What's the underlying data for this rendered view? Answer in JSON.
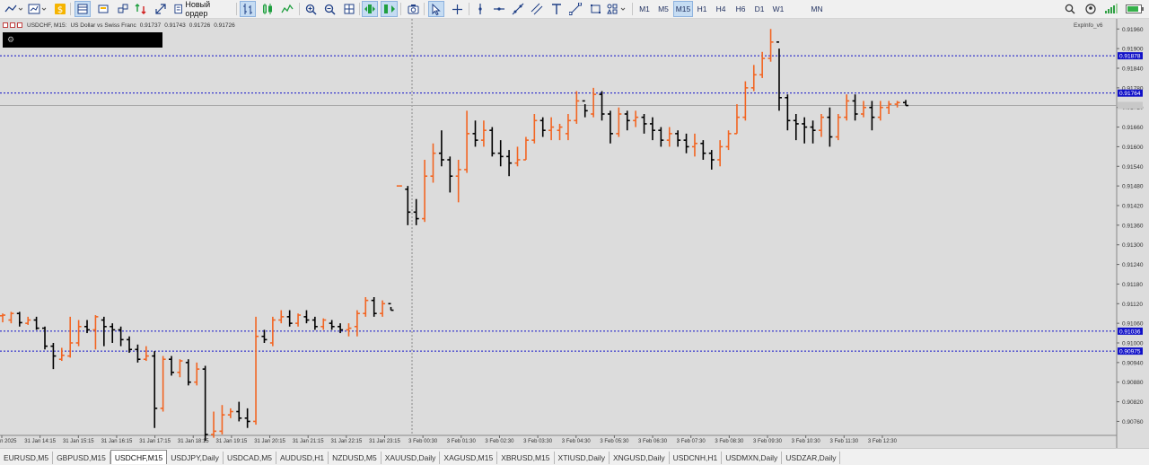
{
  "toolbar": {
    "new_order_label": "Новый ордер",
    "timeframes": [
      "M1",
      "M5",
      "M15",
      "H1",
      "H4",
      "H6",
      "D1",
      "W1",
      "MN"
    ],
    "active_timeframe": "M15"
  },
  "chart_header": {
    "symbol": "USDCHF, M15:",
    "description": "US Dollar vs Swiss Franc",
    "ohlc": [
      "0.91737",
      "0.91743",
      "0.91726",
      "0.91726"
    ],
    "indicator": "ExpInfo_v6"
  },
  "colors": {
    "bull": "#f26522",
    "bear": "#000000",
    "hline": "#1010c8",
    "price_tag": "#1010c8",
    "bg": "#dcdcdc"
  },
  "chart_data": {
    "type": "ohlc-bar",
    "symbol": "USDCHF",
    "timeframe": "M15",
    "ylim": [
      0.9072,
      0.9198
    ],
    "y_ticks": [
      "0.91960",
      "0.91900",
      "0.91840",
      "0.91780",
      "0.91720",
      "0.91660",
      "0.91600",
      "0.91540",
      "0.91480",
      "0.91420",
      "0.91360",
      "0.91300",
      "0.91240",
      "0.91180",
      "0.91120",
      "0.91060",
      "0.91000",
      "0.90940",
      "0.90880",
      "0.90820",
      "0.90760"
    ],
    "x_ticks": [
      "31 Jan 2025",
      "31 Jan 14:15",
      "31 Jan 15:15",
      "31 Jan 16:15",
      "31 Jan 17:15",
      "31 Jan 18:15",
      "31 Jan 19:15",
      "31 Jan 20:15",
      "31 Jan 21:15",
      "31 Jan 22:15",
      "31 Jan 23:15",
      "3 Feb 00:30",
      "3 Feb 01:30",
      "3 Feb 02:30",
      "3 Feb 03:30",
      "3 Feb 04:30",
      "3 Feb 05:30",
      "3 Feb 06:30",
      "3 Feb 07:30",
      "3 Feb 08:30",
      "3 Feb 09:30",
      "3 Feb 10:30",
      "3 Feb 11:30",
      "3 Feb 12:30"
    ],
    "hlines": [
      {
        "price": 0.91878,
        "label": "0.91878"
      },
      {
        "price": 0.91764,
        "label": "0.91764"
      },
      {
        "price": 0.91036,
        "label": "0.91036"
      },
      {
        "price": 0.90975,
        "label": "0.90975"
      }
    ],
    "current_price": 0.91726,
    "bars": [
      [
        0.91083,
        0.9109,
        0.91063,
        0.91085
      ],
      [
        0.9107,
        0.91095,
        0.9106,
        0.9109
      ],
      [
        0.9109,
        0.91095,
        0.9105,
        0.91062
      ],
      [
        0.9106,
        0.9108,
        0.91055,
        0.9107
      ],
      [
        0.9107,
        0.9108,
        0.9104,
        0.91045
      ],
      [
        0.91045,
        0.9105,
        0.9098,
        0.9099
      ],
      [
        0.9099,
        0.91,
        0.9092,
        0.9096
      ],
      [
        0.9095,
        0.90985,
        0.90945,
        0.90962
      ],
      [
        0.9096,
        0.9108,
        0.90955,
        0.91
      ],
      [
        0.91,
        0.9107,
        0.9099,
        0.9105
      ],
      [
        0.9105,
        0.9107,
        0.9103,
        0.9104
      ],
      [
        0.9104,
        0.91085,
        0.9098,
        0.9108
      ],
      [
        0.9107,
        0.9108,
        0.9099,
        0.9105
      ],
      [
        0.9105,
        0.9106,
        0.91,
        0.9104
      ],
      [
        0.9104,
        0.9105,
        0.9099,
        0.9101
      ],
      [
        0.9101,
        0.9102,
        0.9097,
        0.9098
      ],
      [
        0.9098,
        0.90995,
        0.9094,
        0.9095
      ],
      [
        0.9095,
        0.9099,
        0.90945,
        0.9096
      ],
      [
        0.9096,
        0.90975,
        0.9074,
        0.908
      ],
      [
        0.908,
        0.9096,
        0.9079,
        0.9095
      ],
      [
        0.9095,
        0.9096,
        0.909,
        0.9091
      ],
      [
        0.9091,
        0.9095,
        0.90895,
        0.90945
      ],
      [
        0.9094,
        0.9095,
        0.9087,
        0.9088
      ],
      [
        0.9088,
        0.9094,
        0.9087,
        0.9092
      ],
      [
        0.9092,
        0.9093,
        0.907,
        0.9072
      ],
      [
        0.9072,
        0.9079,
        0.9071,
        0.9073
      ],
      [
        0.9073,
        0.9081,
        0.9072,
        0.9078
      ],
      [
        0.9078,
        0.908,
        0.9077,
        0.9079
      ],
      [
        0.9079,
        0.9082,
        0.9076,
        0.9077
      ],
      [
        0.9077,
        0.908,
        0.9074,
        0.9076
      ],
      [
        0.9076,
        0.9108,
        0.9075,
        0.9102
      ],
      [
        0.9102,
        0.9104,
        0.91,
        0.9101
      ],
      [
        0.91,
        0.9108,
        0.9099,
        0.9107
      ],
      [
        0.9107,
        0.911,
        0.9106,
        0.9108
      ],
      [
        0.9108,
        0.911,
        0.9105,
        0.9106
      ],
      [
        0.9106,
        0.9109,
        0.9105,
        0.91085
      ],
      [
        0.9108,
        0.911,
        0.9106,
        0.9107
      ],
      [
        0.9107,
        0.9108,
        0.9104,
        0.9105
      ],
      [
        0.9105,
        0.91075,
        0.9104,
        0.9107
      ],
      [
        0.9106,
        0.9107,
        0.9104,
        0.9105
      ],
      [
        0.9105,
        0.9106,
        0.9103,
        0.9104
      ],
      [
        0.9104,
        0.9106,
        0.9102,
        0.91045
      ],
      [
        0.9105,
        0.911,
        0.9102,
        0.9109
      ],
      [
        0.9109,
        0.9114,
        0.9108,
        0.9113
      ],
      [
        0.9113,
        0.9114,
        0.9108,
        0.9109
      ],
      [
        0.9109,
        0.9113,
        0.9108,
        0.9112
      ],
      [
        0.9112,
        0.9111,
        0.911,
        0.911
      ],
      [
        0.9148,
        0.9148,
        0.9148,
        0.9148
      ],
      [
        0.9147,
        0.9148,
        0.9136,
        0.914
      ],
      [
        0.914,
        0.9144,
        0.9136,
        0.9138
      ],
      [
        0.9138,
        0.9156,
        0.9137,
        0.9151
      ],
      [
        0.9151,
        0.9161,
        0.9149,
        0.9158
      ],
      [
        0.9158,
        0.9165,
        0.9154,
        0.9156
      ],
      [
        0.9156,
        0.9157,
        0.9146,
        0.9151
      ],
      [
        0.9151,
        0.9156,
        0.9143,
        0.9153
      ],
      [
        0.9153,
        0.9171,
        0.9152,
        0.9164
      ],
      [
        0.9164,
        0.9168,
        0.916,
        0.9162
      ],
      [
        0.9162,
        0.9168,
        0.916,
        0.9165
      ],
      [
        0.9165,
        0.9166,
        0.9157,
        0.9158
      ],
      [
        0.9158,
        0.9162,
        0.9154,
        0.9157
      ],
      [
        0.9157,
        0.9159,
        0.9151,
        0.9155
      ],
      [
        0.9155,
        0.916,
        0.9154,
        0.9156
      ],
      [
        0.9156,
        0.9163,
        0.9156,
        0.9162
      ],
      [
        0.9162,
        0.917,
        0.9161,
        0.9168
      ],
      [
        0.9168,
        0.9169,
        0.9163,
        0.9165
      ],
      [
        0.9165,
        0.9169,
        0.9162,
        0.9166
      ],
      [
        0.9165,
        0.9167,
        0.9162,
        0.9166
      ],
      [
        0.9164,
        0.917,
        0.9162,
        0.9168
      ],
      [
        0.9168,
        0.9177,
        0.9167,
        0.9174
      ],
      [
        0.9174,
        0.9173,
        0.9169,
        0.9171
      ],
      [
        0.917,
        0.9178,
        0.9169,
        0.9176
      ],
      [
        0.9176,
        0.9177,
        0.9168,
        0.917
      ],
      [
        0.917,
        0.9171,
        0.9161,
        0.9164
      ],
      [
        0.9164,
        0.9172,
        0.9163,
        0.917
      ],
      [
        0.917,
        0.9171,
        0.9165,
        0.9168
      ],
      [
        0.9168,
        0.9171,
        0.9166,
        0.9169
      ],
      [
        0.9169,
        0.917,
        0.9164,
        0.9167
      ],
      [
        0.9167,
        0.9169,
        0.9162,
        0.9165
      ],
      [
        0.9165,
        0.9166,
        0.916,
        0.9162
      ],
      [
        0.9162,
        0.9166,
        0.916,
        0.9164
      ],
      [
        0.9164,
        0.9165,
        0.916,
        0.9162
      ],
      [
        0.9162,
        0.9164,
        0.9158,
        0.916
      ],
      [
        0.916,
        0.9164,
        0.9157,
        0.9161
      ],
      [
        0.9161,
        0.9162,
        0.9156,
        0.9158
      ],
      [
        0.9158,
        0.9159,
        0.9153,
        0.9156
      ],
      [
        0.9156,
        0.9162,
        0.9154,
        0.916
      ],
      [
        0.916,
        0.9165,
        0.9159,
        0.9164
      ],
      [
        0.9164,
        0.9173,
        0.9164,
        0.9169
      ],
      [
        0.9169,
        0.918,
        0.9168,
        0.9178
      ],
      [
        0.9178,
        0.9185,
        0.9177,
        0.9182
      ],
      [
        0.9182,
        0.9189,
        0.9181,
        0.9187
      ],
      [
        0.9187,
        0.9196,
        0.9186,
        0.9192
      ],
      [
        0.9192,
        0.919,
        0.9171,
        0.9175
      ],
      [
        0.9175,
        0.9176,
        0.9165,
        0.9168
      ],
      [
        0.9168,
        0.917,
        0.9162,
        0.9167
      ],
      [
        0.9167,
        0.9169,
        0.9161,
        0.9166
      ],
      [
        0.9166,
        0.9168,
        0.9161,
        0.9165
      ],
      [
        0.9165,
        0.917,
        0.9163,
        0.9169
      ],
      [
        0.9169,
        0.9172,
        0.916,
        0.9163
      ],
      [
        0.9163,
        0.917,
        0.9162,
        0.9169
      ],
      [
        0.9169,
        0.9176,
        0.9168,
        0.9174
      ],
      [
        0.9174,
        0.9176,
        0.9168,
        0.917
      ],
      [
        0.917,
        0.9174,
        0.9169,
        0.9172
      ],
      [
        0.9172,
        0.9174,
        0.9165,
        0.9169
      ],
      [
        0.9169,
        0.9174,
        0.9168,
        0.9172
      ],
      [
        0.9172,
        0.9174,
        0.917,
        0.9173
      ],
      [
        0.9173,
        0.9174,
        0.9172,
        0.91735
      ],
      [
        0.91735,
        0.91743,
        0.91726,
        0.91726
      ]
    ]
  },
  "tabs": [
    "EURUSD,M5",
    "GBPUSD,M15",
    "USDCHF,M15",
    "USDJPY,Daily",
    "USDCAD,M5",
    "AUDUSD,H1",
    "NZDUSD,M5",
    "XAUUSD,Daily",
    "XAGUSD,M15",
    "XBRUSD,M15",
    "XTIUSD,Daily",
    "XNGUSD,Daily",
    "USDCNH,H1",
    "USDMXN,Daily",
    "USDZAR,Daily"
  ],
  "active_tab": "USDCHF,M15"
}
